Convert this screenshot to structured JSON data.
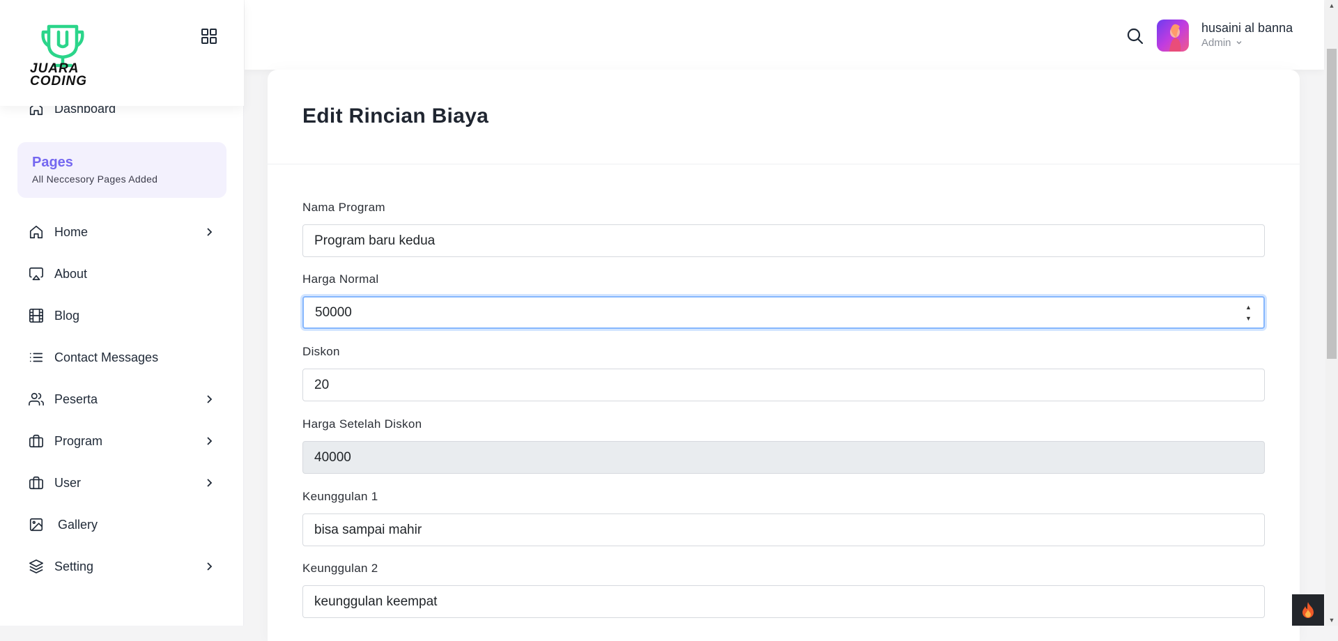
{
  "brand": {
    "logo_text_line1": "JUARA",
    "logo_text_line2": "CODING"
  },
  "sidebar": {
    "dashboard": "Dashboard",
    "pages_title": "Pages",
    "pages_sub": "All Neccesory Pages Added",
    "items": [
      {
        "label": "Home",
        "icon": "home-icon",
        "has_arrow": true
      },
      {
        "label": "About",
        "icon": "airplay-icon",
        "has_arrow": false
      },
      {
        "label": "Blog",
        "icon": "film-icon",
        "has_arrow": false
      },
      {
        "label": "Contact Messages",
        "icon": "list-icon",
        "has_arrow": false
      },
      {
        "label": "Peserta",
        "icon": "users-icon",
        "has_arrow": true
      },
      {
        "label": "Program",
        "icon": "briefcase-icon",
        "has_arrow": true
      },
      {
        "label": "User",
        "icon": "briefcase-icon",
        "has_arrow": true
      },
      {
        "label": "Gallery",
        "icon": "image-icon",
        "has_arrow": false
      },
      {
        "label": "Setting",
        "icon": "layers-icon",
        "has_arrow": true
      }
    ]
  },
  "header": {
    "user_name": "husaini al banna",
    "user_role": "Admin"
  },
  "form": {
    "title": "Edit Rincian Biaya",
    "fields": [
      {
        "label": "Nama Program",
        "value": "Program baru kedua"
      },
      {
        "label": "Harga Normal",
        "value": "50000"
      },
      {
        "label": "Diskon",
        "value": "20"
      },
      {
        "label": "Harga Setelah Diskon",
        "value": "40000"
      },
      {
        "label": "Keunggulan 1",
        "value": "bisa sampai mahir"
      },
      {
        "label": "Keunggulan 2",
        "value": "keunggulan keempat"
      }
    ]
  },
  "colors": {
    "accent": "#7467f0",
    "logo_green": "#2bd58a",
    "focus": "#86b7fe"
  }
}
